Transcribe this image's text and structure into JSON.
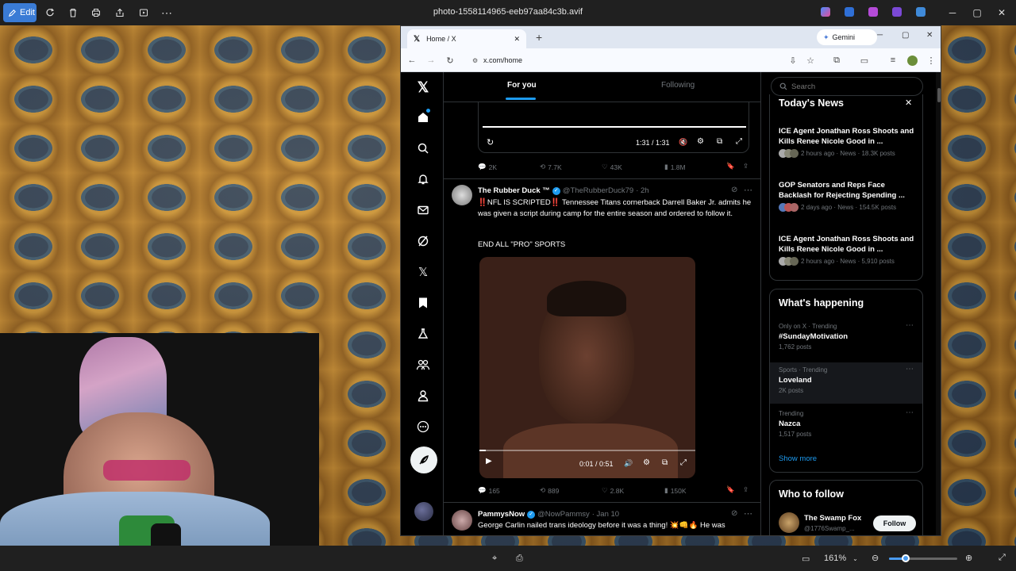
{
  "viewer": {
    "edit_label": "Edit",
    "file_title": "photo-1558114965-eeb97aa84c3b.avif",
    "zoom": "161%"
  },
  "browser": {
    "tab_title": "Home / X",
    "url": "x.com/home",
    "gemini_label": "Gemini"
  },
  "feed": {
    "tabs": [
      "For you",
      "Following"
    ],
    "video1": {
      "time": "1:31 / 1:31",
      "replies": "2K",
      "reposts": "7.7K",
      "likes": "43K",
      "views": "1.8M"
    },
    "post": {
      "author": "The Rubber Duck ™",
      "handle": "@TheRubberDuck79",
      "time": "· 2h",
      "text1": "‼️NFL IS SCRIPTED‼️ Tennessee Titans cornerback Darrell Baker Jr. admits he was given a script during camp for the entire season and ordered to follow it.",
      "text2": "END ALL \"PRO\" SPORTS",
      "video_time": "0:01 / 0:51",
      "replies": "165",
      "reposts": "889",
      "likes": "2.8K",
      "views": "150K"
    },
    "post2": {
      "author": "PammysNow",
      "handle": "@NowPammsy",
      "time": "· Jan 10",
      "text": "George Carlin nailed trans ideology before it was a thing! 💥👊🔥 He was"
    }
  },
  "right": {
    "search_placeholder": "Search",
    "news_title": "Today's News",
    "news": [
      {
        "title": "ICE Agent Jonathan Ross Shoots and Kills Renee Nicole Good in ...",
        "meta": "2 hours ago · News · 18.3K posts"
      },
      {
        "title": "GOP Senators and Reps Face Backlash for Rejecting Spending ...",
        "meta": "2 days ago · News · 154.5K posts"
      },
      {
        "title": "ICE Agent Jonathan Ross Shoots and Kills Renee Nicole Good in ...",
        "meta": "2 hours ago · News · 5,910 posts"
      }
    ],
    "happening_title": "What's happening",
    "trends": [
      {
        "context": "Only on X · Trending",
        "name": "#SundayMotivation",
        "count": "1,762 posts"
      },
      {
        "context": "Sports · Trending",
        "name": "Loveland",
        "count": "2K posts"
      },
      {
        "context": "Trending",
        "name": "Nazca",
        "count": "1,517 posts"
      }
    ],
    "show_more": "Show more",
    "wtf_title": "Who to follow",
    "wtf_name": "The Swamp Fox",
    "wtf_handle": "@1776Swamp_...",
    "follow_label": "Follow"
  },
  "colors": {
    "accent": "#1d9bf0",
    "x_bg": "#000000",
    "viewer_bar": "#202020"
  }
}
